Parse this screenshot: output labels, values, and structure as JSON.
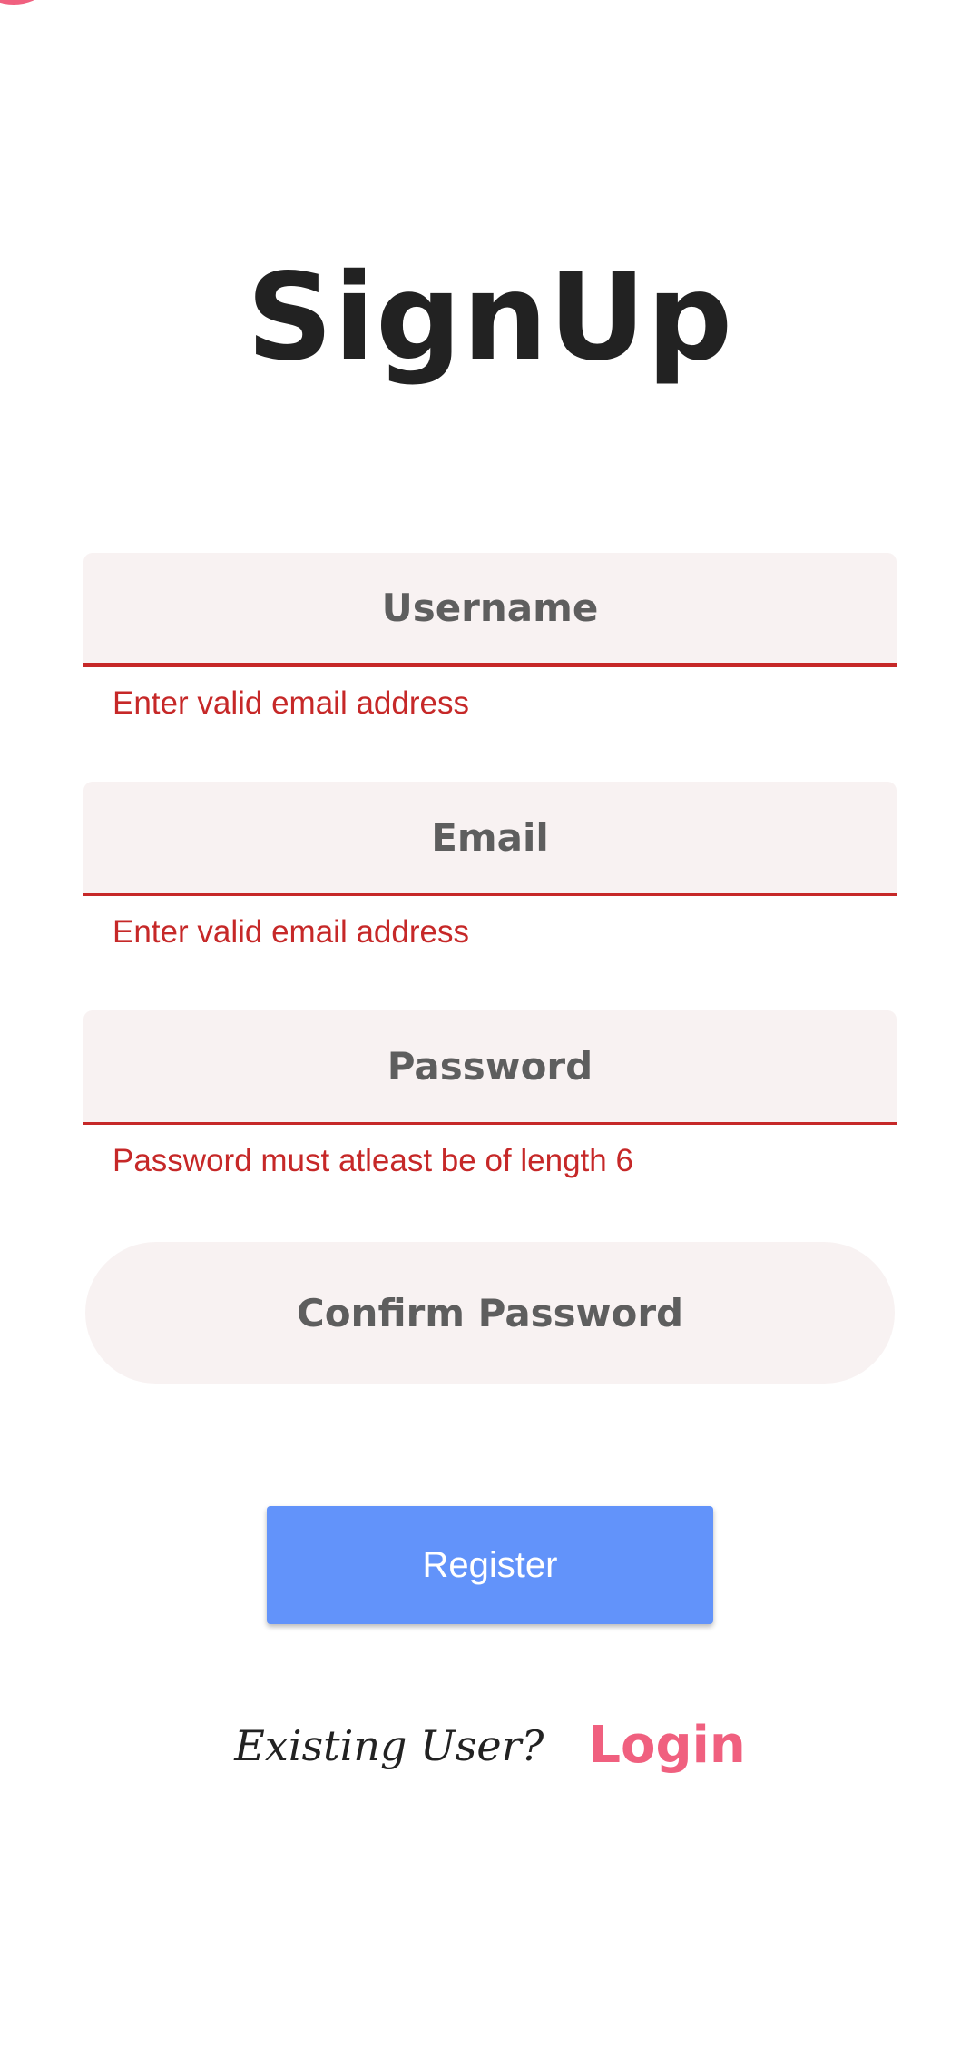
{
  "page": {
    "title": "SignUp"
  },
  "form": {
    "username": {
      "placeholder": "Username",
      "error": "Enter valid email address"
    },
    "email": {
      "placeholder": "Email",
      "error": "Enter valid email address"
    },
    "password": {
      "placeholder": "Password",
      "error": "Password must atleast be of length 6"
    },
    "confirm_password": {
      "placeholder": "Confirm Password"
    }
  },
  "actions": {
    "register_label": "Register"
  },
  "footer": {
    "prompt": "Existing User?",
    "login_label": "Login"
  },
  "colors": {
    "error": "#c62828",
    "field_bg": "#f8f2f2",
    "button": "#6293fa",
    "accent": "#f0607f",
    "title": "#222222"
  }
}
